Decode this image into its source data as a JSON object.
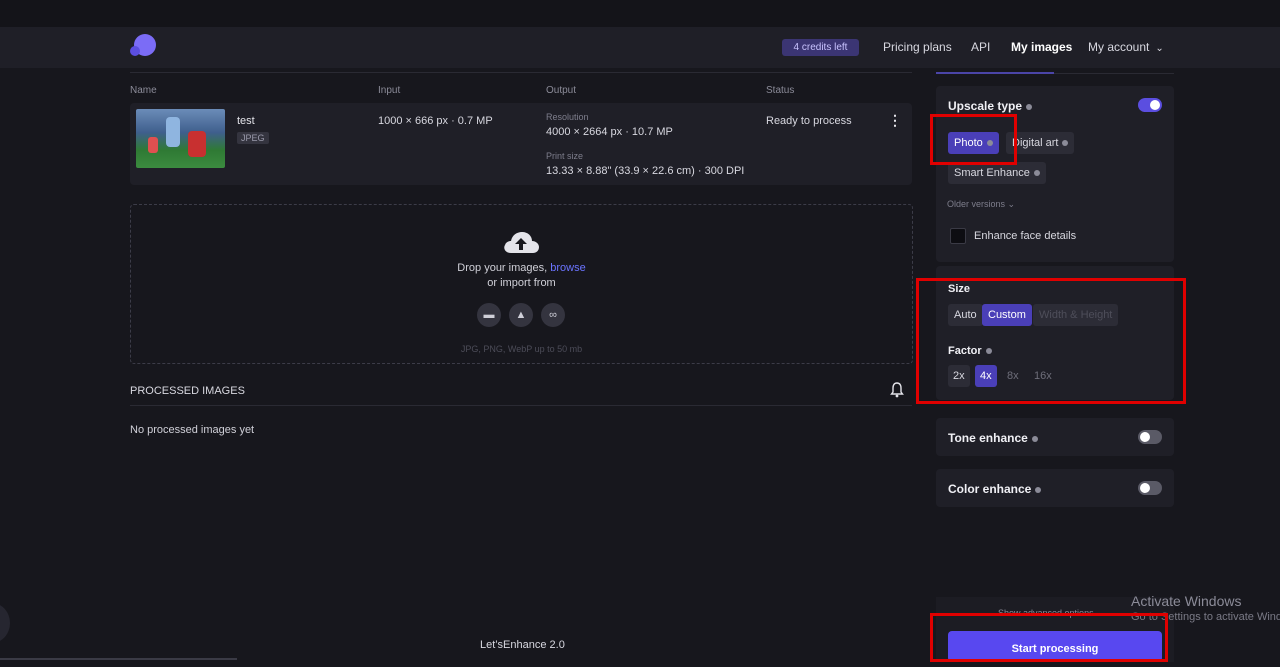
{
  "nav": {
    "credits": "4 credits left",
    "pricing": "Pricing plans",
    "api": "API",
    "my_images": "My images",
    "my_account": "My account",
    "account_icon": "chevron-down-icon"
  },
  "table": {
    "headers": [
      "Name",
      "Input",
      "Output",
      "Status"
    ],
    "row": {
      "name": "test",
      "type": "JPEG",
      "input": "1000 × 666 px · 0.7 MP",
      "resolution_label": "Resolution",
      "resolution": "4000 × 2664 px · 10.7 MP",
      "print_label": "Print size",
      "print": "13.33 × 8.88\" (33.9 × 22.6 cm) · 300 DPI",
      "status": "Ready to process"
    }
  },
  "upload": {
    "line1": "Drop your images, ",
    "browse": "browse",
    "line2": "or import from",
    "note": "JPG, PNG, WebP up to 50 mb",
    "icons": [
      "folder-icon",
      "google-drive-icon",
      "link-icon"
    ]
  },
  "processed": {
    "title": "PROCESSED IMAGES",
    "empty": "No processed images yet"
  },
  "footer": {
    "brand": "Let’sEnhance 2.0"
  },
  "panel": {
    "upscale": {
      "title": "Upscale type",
      "enabled": true,
      "options": [
        "Photo",
        "Digital art",
        "Smart Enhance"
      ],
      "selected": "Photo",
      "older": "Older versions ⌄",
      "face": "Enhance face details"
    },
    "size": {
      "title": "Size",
      "options": [
        "Auto",
        "Custom",
        "Width & Height"
      ],
      "selected": "Custom",
      "factor_title": "Factor",
      "factors": [
        "2x",
        "4x",
        "8x",
        "16x"
      ],
      "factor_selected": "4x"
    },
    "tone": {
      "title": "Tone enhance",
      "enabled": false
    },
    "color": {
      "title": "Color enhance",
      "enabled": false
    },
    "advanced": "Show advanced options",
    "start": "Start processing"
  },
  "windows": {
    "line1": "Activate Windows",
    "line2": "Go to Settings to activate Windows."
  },
  "colors": {
    "accent": "#5848f0",
    "selected_chip": "#4a3fb8",
    "highlight": "#e00000"
  }
}
